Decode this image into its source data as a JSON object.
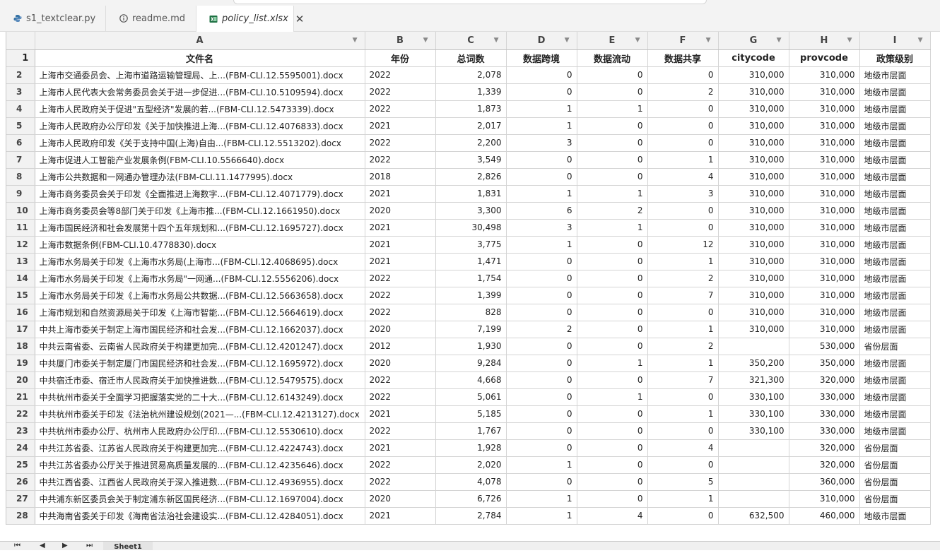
{
  "tabs": [
    {
      "label": "s1_textclear.py",
      "icon": "python-icon",
      "color": "#3572a5"
    },
    {
      "label": "readme.md",
      "icon": "info-icon",
      "color": "#555555"
    },
    {
      "label": "policy_list.xlsx",
      "icon": "excel-icon",
      "color": "#1f7244",
      "active": true
    }
  ],
  "columns": [
    "A",
    "B",
    "C",
    "D",
    "E",
    "F",
    "G",
    "H",
    "I"
  ],
  "header_row": {
    "num": "1",
    "cells": [
      "文件名",
      "年份",
      "总词数",
      "数据跨境",
      "数据流动",
      "数据共享",
      "citycode",
      "provcode",
      "政策级别"
    ]
  },
  "rows": [
    {
      "num": "2",
      "cells": [
        "上海市交通委员会、上海市道路运输管理局、上...(FBM-CLI.12.5595001).docx",
        "2022",
        "2,078",
        "0",
        "0",
        "0",
        "310,000",
        "310,000",
        "地级市层面"
      ]
    },
    {
      "num": "3",
      "cells": [
        "上海市人民代表大会常务委员会关于进一步促进...(FBM-CLI.10.5109594).docx",
        "2022",
        "1,339",
        "0",
        "0",
        "2",
        "310,000",
        "310,000",
        "地级市层面"
      ]
    },
    {
      "num": "4",
      "cells": [
        "上海市人民政府关于促进\"五型经济\"发展的若...(FBM-CLI.12.5473339).docx",
        "2022",
        "1,873",
        "1",
        "1",
        "0",
        "310,000",
        "310,000",
        "地级市层面"
      ]
    },
    {
      "num": "5",
      "cells": [
        "上海市人民政府办公厅印发《关于加快推进上海...(FBM-CLI.12.4076833).docx",
        "2021",
        "2,017",
        "1",
        "0",
        "0",
        "310,000",
        "310,000",
        "地级市层面"
      ]
    },
    {
      "num": "6",
      "cells": [
        "上海市人民政府印发《关于支持中国(上海)自由...(FBM-CLI.12.5513202).docx",
        "2022",
        "2,200",
        "3",
        "0",
        "0",
        "310,000",
        "310,000",
        "地级市层面"
      ]
    },
    {
      "num": "7",
      "cells": [
        "上海市促进人工智能产业发展条例(FBM-CLI.10.5566640).docx",
        "2022",
        "3,549",
        "0",
        "0",
        "1",
        "310,000",
        "310,000",
        "地级市层面"
      ]
    },
    {
      "num": "8",
      "cells": [
        "上海市公共数据和一网通办管理办法(FBM-CLI.11.1477995).docx",
        "2018",
        "2,826",
        "0",
        "0",
        "4",
        "310,000",
        "310,000",
        "地级市层面"
      ]
    },
    {
      "num": "9",
      "cells": [
        "上海市商务委员会关于印发《全面推进上海数字...(FBM-CLI.12.4071779).docx",
        "2021",
        "1,831",
        "1",
        "1",
        "3",
        "310,000",
        "310,000",
        "地级市层面"
      ]
    },
    {
      "num": "10",
      "cells": [
        "上海市商务委员会等8部门关于印发《上海市推...(FBM-CLI.12.1661950).docx",
        "2020",
        "3,300",
        "6",
        "2",
        "0",
        "310,000",
        "310,000",
        "地级市层面"
      ]
    },
    {
      "num": "11",
      "cells": [
        "上海市国民经济和社会发展第十四个五年规划和...(FBM-CLI.12.1695727).docx",
        "2021",
        "30,498",
        "3",
        "1",
        "0",
        "310,000",
        "310,000",
        "地级市层面"
      ]
    },
    {
      "num": "12",
      "cells": [
        "上海市数据条例(FBM-CLI.10.4778830).docx",
        "2021",
        "3,775",
        "1",
        "0",
        "12",
        "310,000",
        "310,000",
        "地级市层面"
      ]
    },
    {
      "num": "13",
      "cells": [
        "上海市水务局关于印发《上海市水务局(上海市...(FBM-CLI.12.4068695).docx",
        "2021",
        "1,471",
        "0",
        "0",
        "1",
        "310,000",
        "310,000",
        "地级市层面"
      ]
    },
    {
      "num": "14",
      "cells": [
        "上海市水务局关于印发《上海市水务局\"一网通...(FBM-CLI.12.5556206).docx",
        "2022",
        "1,754",
        "0",
        "0",
        "2",
        "310,000",
        "310,000",
        "地级市层面"
      ]
    },
    {
      "num": "15",
      "cells": [
        "上海市水务局关于印发《上海市水务局公共数据...(FBM-CLI.12.5663658).docx",
        "2022",
        "1,399",
        "0",
        "0",
        "7",
        "310,000",
        "310,000",
        "地级市层面"
      ]
    },
    {
      "num": "16",
      "cells": [
        "上海市规划和自然资源局关于印发《上海市智能...(FBM-CLI.12.5664619).docx",
        "2022",
        "828",
        "0",
        "0",
        "0",
        "310,000",
        "310,000",
        "地级市层面"
      ]
    },
    {
      "num": "17",
      "cells": [
        "中共上海市委关于制定上海市国民经济和社会发...(FBM-CLI.12.1662037).docx",
        "2020",
        "7,199",
        "2",
        "0",
        "1",
        "310,000",
        "310,000",
        "地级市层面"
      ]
    },
    {
      "num": "18",
      "cells": [
        "中共云南省委、云南省人民政府关于构建更加完...(FBM-CLI.12.4201247).docx",
        "2012",
        "1,930",
        "0",
        "0",
        "2",
        "",
        "530,000",
        "省份层面"
      ]
    },
    {
      "num": "19",
      "cells": [
        "中共厦门市委关于制定厦门市国民经济和社会发...(FBM-CLI.12.1695972).docx",
        "2020",
        "9,284",
        "0",
        "1",
        "1",
        "350,200",
        "350,000",
        "地级市层面"
      ]
    },
    {
      "num": "20",
      "cells": [
        "中共宿迁市委、宿迁市人民政府关于加快推进数...(FBM-CLI.12.5479575).docx",
        "2022",
        "4,668",
        "0",
        "0",
        "7",
        "321,300",
        "320,000",
        "地级市层面"
      ]
    },
    {
      "num": "21",
      "cells": [
        "中共杭州市委关于全面学习把握落实党的二十大...(FBM-CLI.12.6143249).docx",
        "2022",
        "5,061",
        "0",
        "1",
        "0",
        "330,100",
        "330,000",
        "地级市层面"
      ]
    },
    {
      "num": "22",
      "cells": [
        "中共杭州市委关于印发《法治杭州建设规划(2021—...(FBM-CLI.12.4213127).docx",
        "2021",
        "5,185",
        "0",
        "0",
        "1",
        "330,100",
        "330,000",
        "地级市层面"
      ]
    },
    {
      "num": "23",
      "cells": [
        "中共杭州市委办公厅、杭州市人民政府办公厅印...(FBM-CLI.12.5530610).docx",
        "2022",
        "1,767",
        "0",
        "0",
        "0",
        "330,100",
        "330,000",
        "地级市层面"
      ]
    },
    {
      "num": "24",
      "cells": [
        "中共江苏省委、江苏省人民政府关于构建更加完...(FBM-CLI.12.4224743).docx",
        "2021",
        "1,928",
        "0",
        "0",
        "4",
        "",
        "320,000",
        "省份层面"
      ]
    },
    {
      "num": "25",
      "cells": [
        "中共江苏省委办公厅关于推进贸易高质量发展的...(FBM-CLI.12.4235646).docx",
        "2022",
        "2,020",
        "1",
        "0",
        "0",
        "",
        "320,000",
        "省份层面"
      ]
    },
    {
      "num": "26",
      "cells": [
        "中共江西省委、江西省人民政府关于深入推进数...(FBM-CLI.12.4936955).docx",
        "2022",
        "4,078",
        "0",
        "0",
        "5",
        "",
        "360,000",
        "省份层面"
      ]
    },
    {
      "num": "27",
      "cells": [
        "中共浦东新区委员会关于制定浦东新区国民经济...(FBM-CLI.12.1697004).docx",
        "2020",
        "6,726",
        "1",
        "0",
        "1",
        "",
        "310,000",
        "省份层面"
      ]
    },
    {
      "num": "28",
      "cells": [
        "中共海南省委关于印发《海南省法治社会建设实...(FBM-CLI.12.4284051).docx",
        "2021",
        "2,784",
        "1",
        "4",
        "0",
        "632,500",
        "460,000",
        "地级市层面"
      ]
    }
  ],
  "sheet_tab": "Sheet1",
  "nav_buttons": [
    "first-icon",
    "prev-icon",
    "next-icon",
    "last-icon"
  ]
}
